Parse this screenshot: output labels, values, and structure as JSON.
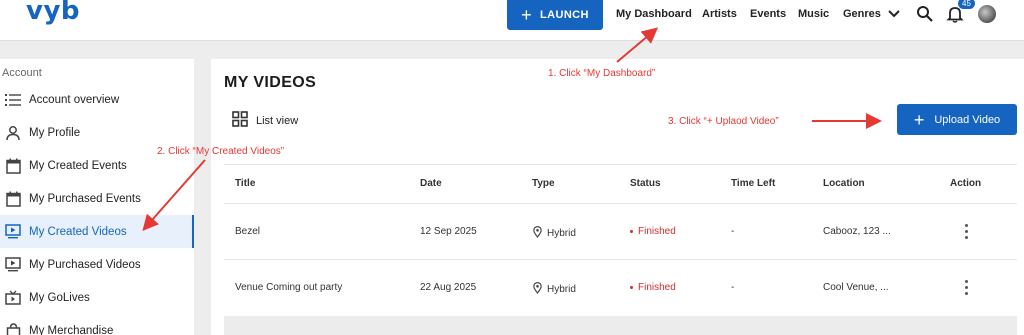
{
  "header": {
    "logo": "vyb",
    "launch_label": "LAUNCH",
    "nav": [
      "My Dashboard",
      "Artists",
      "Events",
      "Music",
      "Genres"
    ],
    "notification_count": "45"
  },
  "sidebar": {
    "heading": "Account",
    "items": [
      {
        "label": "Account overview",
        "icon": "list-icon"
      },
      {
        "label": "My Profile",
        "icon": "person-icon"
      },
      {
        "label": "My Created Events",
        "icon": "calendar-icon"
      },
      {
        "label": "My Purchased Events",
        "icon": "calendar-icon"
      },
      {
        "label": "My Created Videos",
        "icon": "video-icon",
        "active": true
      },
      {
        "label": "My Purchased Videos",
        "icon": "video-icon"
      },
      {
        "label": "My GoLives",
        "icon": "tv-icon"
      },
      {
        "label": "My Merchandise",
        "icon": "bag-icon"
      }
    ]
  },
  "main": {
    "title": "MY VIDEOS",
    "list_view_label": "List view",
    "upload_label": "Upload Video",
    "table": {
      "columns": [
        "Title",
        "Date",
        "Type",
        "Status",
        "Time Left",
        "Location",
        "Action"
      ],
      "rows": [
        {
          "title": "Bezel",
          "date": "12 Sep 2025",
          "type": "Hybrid",
          "status": "Finished",
          "time_left": "-",
          "location": "Cabooz, 123 ..."
        },
        {
          "title": "Venue Coming out party",
          "date": "22 Aug 2025",
          "type": "Hybrid",
          "status": "Finished",
          "time_left": "-",
          "location": "Cool Venue, ..."
        }
      ]
    }
  },
  "annotations": {
    "step1": "1. Click “My Dashboard”",
    "step2": "2. Click “My Created Videos”",
    "step3": "3. Click “+ Uplaod Video”"
  },
  "colors": {
    "brand": "#1565c0",
    "status_finished": "#d32f2f",
    "annotation": "#e53935"
  }
}
